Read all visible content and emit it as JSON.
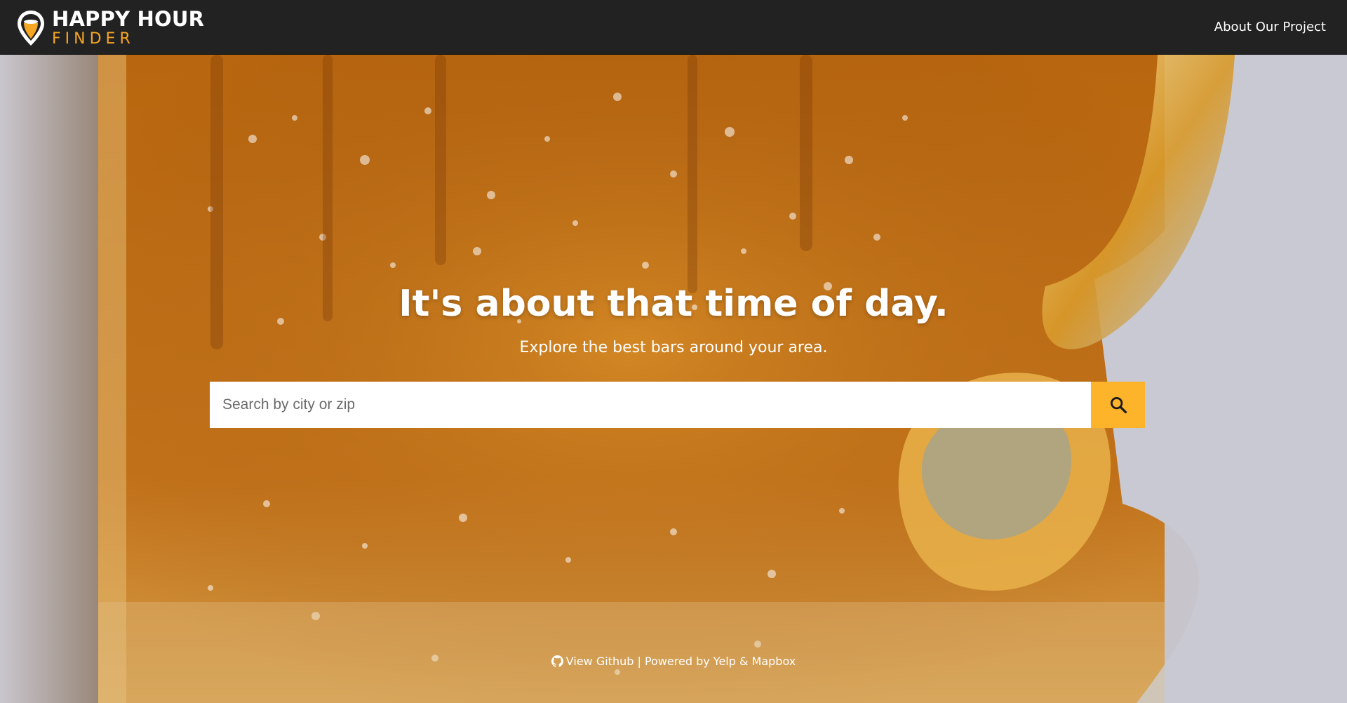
{
  "navbar": {
    "brand_line1": "HAPPY HOUR",
    "brand_line2": "FINDER",
    "logo_icon": "map-pin-beer-icon",
    "about_link": "About Our Project"
  },
  "hero": {
    "title": "It's about that time of day.",
    "subtitle": "Explore the best bars around your area.",
    "background": "photo of a frosted beer mug close-up"
  },
  "search": {
    "placeholder": "Search by city or zip",
    "value": "",
    "button_icon": "search-icon"
  },
  "footer": {
    "github_icon": "github-icon",
    "github_label": "View Github",
    "separator": "|",
    "powered_label": "Powered by Yelp & Mapbox"
  },
  "colors": {
    "navbar_bg": "#222222",
    "accent": "#fdb42b",
    "brand_secondary": "#f5a623",
    "text_light": "#ffffff"
  }
}
